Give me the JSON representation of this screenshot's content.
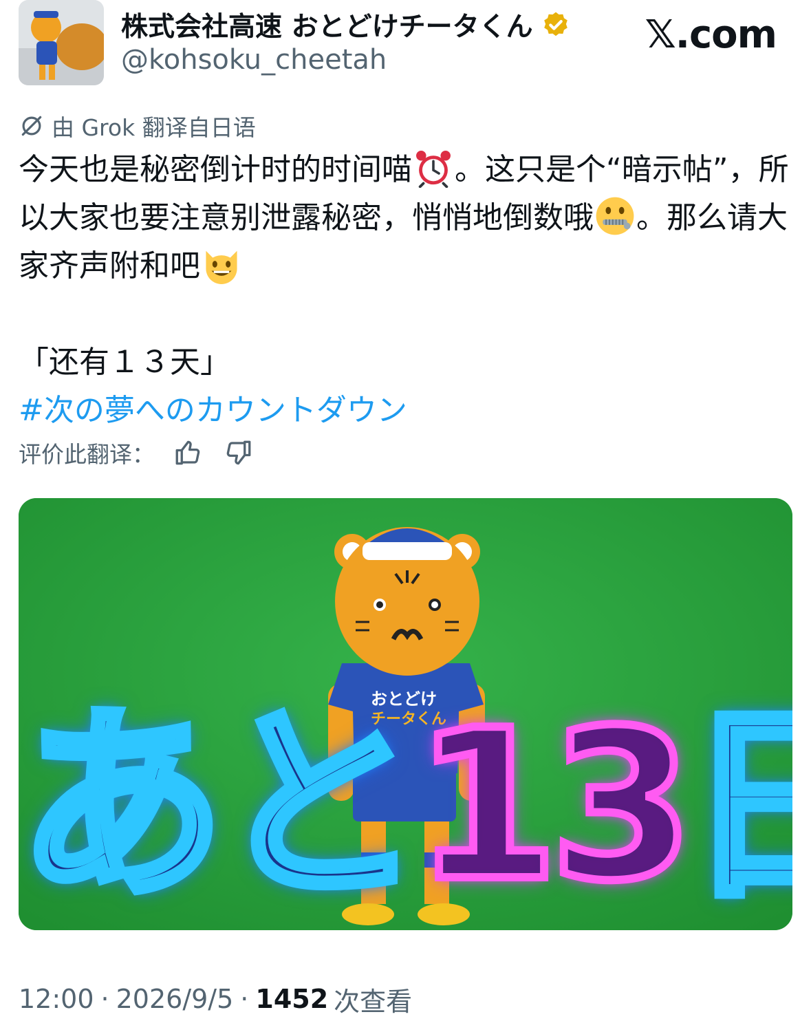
{
  "author": {
    "display_name": "株式会社高速 おとどけチータくん",
    "handle": "@kohsoku_cheetah",
    "verified_icon": "verified-badge-icon",
    "verified_color": "#e8b10b"
  },
  "site_logo": "𝕏.com",
  "translation": {
    "icon": "translate-icon",
    "note": "由 Grok 翻译自日语"
  },
  "tweet": {
    "line1_a": "今天也是秘密倒计时的时间喵",
    "line1_emoji": "alarm-clock-emoji",
    "line1_b": "。这只是个“暗示帖”，所以大家也要注意别泄露秘密，悄悄地倒数哦",
    "line2_emoji": "zipper-mouth-face-emoji",
    "line2_b": "。那么请大家齐声附和吧",
    "line2_emoji2": "grinning-cat-emoji",
    "quote": "「还有１３天」",
    "hashtag": "#次の夢へのカウントダウン",
    "hashtag_color": "#1d9bf0"
  },
  "rating": {
    "label": "评价此翻译：",
    "thumbs_up_icon": "thumbs-up-icon",
    "thumbs_down_icon": "thumbs-down-icon"
  },
  "media": {
    "background_color": "#25a23a",
    "overlay_text_part1": "あと",
    "overlay_text_part2": "13",
    "overlay_text_part3": "日",
    "neon_blue": "#2ec6ff",
    "neon_pink": "#ff5bf2",
    "shirt_text_line1": "おとどけ",
    "shirt_text_line2": "チータくん"
  },
  "meta": {
    "time": "12:00",
    "separator": "·",
    "date": "2026/9/5",
    "views": "1452",
    "views_label": "次查看"
  }
}
